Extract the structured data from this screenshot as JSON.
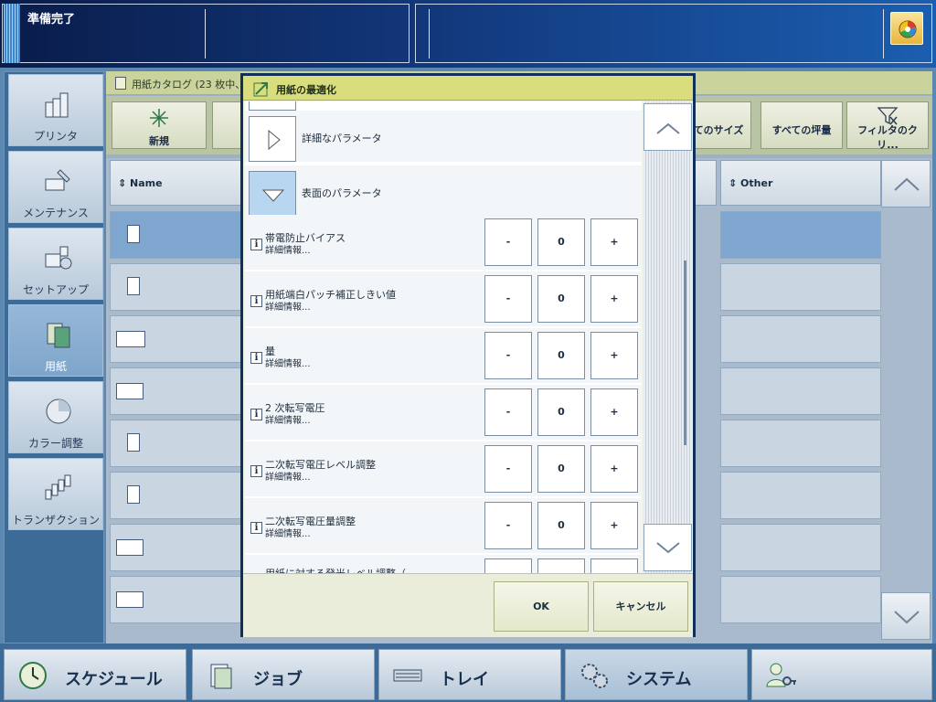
{
  "topbar": {
    "status": "準備完了",
    "home_icon": "home-wheel-icon"
  },
  "sidebar": {
    "items": [
      {
        "label": "プリンタ",
        "icon": "printer-icon"
      },
      {
        "label": "メンテナンス",
        "icon": "maintenance-icon"
      },
      {
        "label": "セットアップ",
        "icon": "setup-icon"
      },
      {
        "label": "用紙",
        "icon": "media-icon",
        "active": true
      },
      {
        "label": "カラー調整",
        "icon": "color-icon"
      },
      {
        "label": "トランザクション",
        "icon": "transaction-icon"
      }
    ]
  },
  "catalog": {
    "title": "用紙カタログ (23 枚中、",
    "toolbar": {
      "new_label": "新規",
      "all_sizes": "てのサイズ",
      "all_weights": "すべての坪量",
      "filter_clear": "フィルタのクリ..."
    },
    "columns": {
      "name": "Name",
      "other": "Other"
    }
  },
  "dialog": {
    "title": "用紙の最適化",
    "sections": [
      {
        "label": "詳細なパラメータ",
        "expanded": false
      },
      {
        "label": "表面のパラメータ",
        "expanded": true
      }
    ],
    "detail_label": "詳細情報...",
    "params": [
      {
        "name": "帯電防止バイアス",
        "value": "0"
      },
      {
        "name": "用紙端白パッチ補正しきい値",
        "value": "0"
      },
      {
        "name": "量",
        "value": "0"
      },
      {
        "name": "2 次転写電圧",
        "value": "0"
      },
      {
        "name": "二次転写電圧レベル調整",
        "value": "0"
      },
      {
        "name": "二次転写電圧量調整",
        "value": "0"
      },
      {
        "name": "用紙に対する発光レベル調整（",
        "value": ""
      }
    ],
    "minus_label": "-",
    "plus_label": "+",
    "ok_label": "OK",
    "cancel_label": "キャンセル"
  },
  "bottom": {
    "tabs": [
      {
        "label": "スケジュール",
        "icon": "clock-icon"
      },
      {
        "label": "ジョブ",
        "icon": "job-icon"
      },
      {
        "label": "トレイ",
        "icon": "tray-icon"
      },
      {
        "label": "システム",
        "icon": "system-gear-icon",
        "active": true
      },
      {
        "label": "",
        "icon": "user-key-icon"
      }
    ]
  },
  "colors": {
    "accent": "#d9dd7e",
    "dialog_border": "#10305a",
    "selected_row": "#7fa6cf"
  }
}
